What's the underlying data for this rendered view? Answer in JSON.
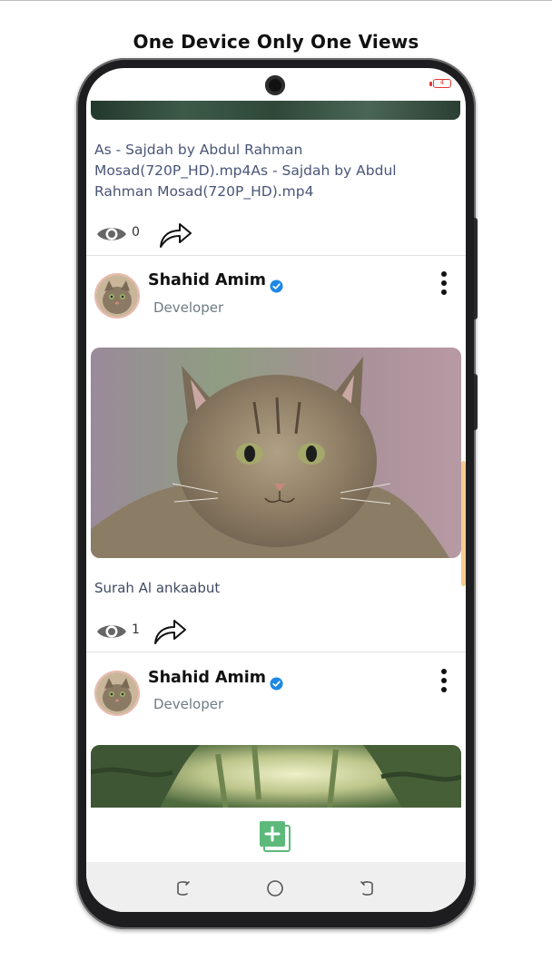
{
  "headline": "One Device Only One Views",
  "status_bar": {
    "battery": "4"
  },
  "posts": [
    {
      "caption": "As - Sajdah by Abdul Rahman Mosad(720P_HD).mp4As - Sajdah by Abdul Rahman Mosad(720P_HD).mp4",
      "views": "0"
    },
    {
      "author": "Shahid Amim",
      "role": "Developer",
      "caption": "Surah Al ankaabut",
      "views": "1"
    },
    {
      "author": "Shahid Amim",
      "role": "Developer"
    }
  ],
  "icons": {
    "views": "eye-icon",
    "share": "share-arrow-icon",
    "verified": "verified-badge-icon",
    "more": "more-vertical-icon",
    "add": "add-post-icon",
    "nav_recents": "recent-apps-icon",
    "nav_home": "home-circle-icon",
    "nav_back": "back-icon"
  },
  "colors": {
    "accent_green": "#5cb97a",
    "verified_blue": "#1e88e5",
    "battery_red": "#e53935",
    "caption_text": "#4a5578"
  }
}
